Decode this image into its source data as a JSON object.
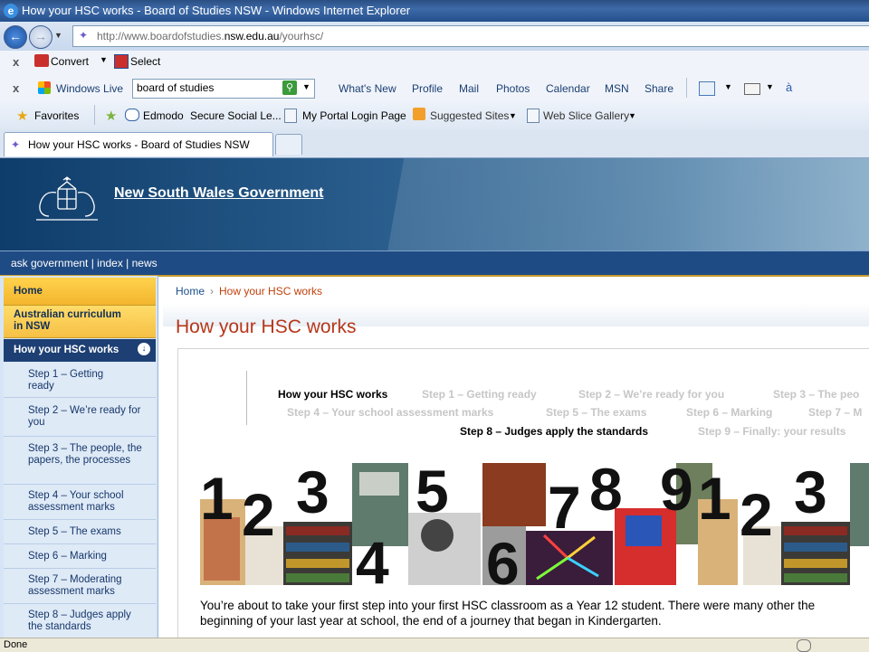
{
  "window": {
    "title": "How your HSC works - Board of Studies NSW - Windows Internet Explorer"
  },
  "address": {
    "url_prefix": "http://www.boardofstudies.",
    "url_domain": "nsw.edu.au",
    "url_path": "/yourhsc/"
  },
  "toolbar_convert": {
    "close": "x",
    "convert": "Convert",
    "select": "Select"
  },
  "toolbar_live": {
    "close": "x",
    "brand": "Windows Live",
    "search_value": "board of studies",
    "links": [
      "What's New",
      "Profile",
      "Mail",
      "Photos",
      "Calendar",
      "MSN",
      "Share"
    ]
  },
  "favorites_bar": {
    "favorites": "Favorites",
    "items": [
      "Edmodo",
      "Secure Social Le...",
      "My Portal Login Page",
      "Suggested Sites",
      "Web Slice Gallery"
    ]
  },
  "tabs": {
    "active": "How your HSC works - Board of Studies NSW"
  },
  "banner": {
    "government": "New South Wales Government"
  },
  "govbar": {
    "links": "ask government | index | news"
  },
  "sidebar": {
    "items": [
      {
        "label": "Home"
      },
      {
        "label": "Australian curriculum in NSW"
      },
      {
        "label": "How your HSC works"
      },
      {
        "label": "Step 1 – Getting ready"
      },
      {
        "label": "Step 2 – We’re ready for you"
      },
      {
        "label": "Step 3 – The people, the papers, the processes"
      },
      {
        "label": "Step 4 – Your school assessment marks"
      },
      {
        "label": "Step 5 – The exams"
      },
      {
        "label": "Step 6 – Marking"
      },
      {
        "label": "Step 7 – Moderating assessment marks"
      },
      {
        "label": "Step 8 – Judges apply the standards"
      }
    ]
  },
  "breadcrumb": {
    "home": "Home",
    "sep": "›",
    "current": "How your HSC works"
  },
  "main": {
    "title": "How your HSC works",
    "stepnav": {
      "row1": [
        "How your HSC works",
        "Step 1 – Getting ready",
        "Step 2 – We’re ready for you",
        "Step 3 – The peo"
      ],
      "row2": [
        "Step 4 – Your school assessment marks",
        "Step 5 – The exams",
        "Step 6 – Marking",
        "Step 7 – M"
      ],
      "row3": [
        "Step 8 – Judges apply the standards",
        "Step 9 – Finally: your results"
      ]
    },
    "collage_numbers": [
      "1",
      "2",
      "3",
      "4",
      "5",
      "6",
      "7",
      "8",
      "9",
      "1",
      "2",
      "3"
    ],
    "intro": "You’re about to take your first step into your first HSC classroom as a Year 12 student. There were many other the beginning of your last year at school, the end of a journey that began in Kindergarten."
  },
  "status": {
    "text": "Done"
  }
}
